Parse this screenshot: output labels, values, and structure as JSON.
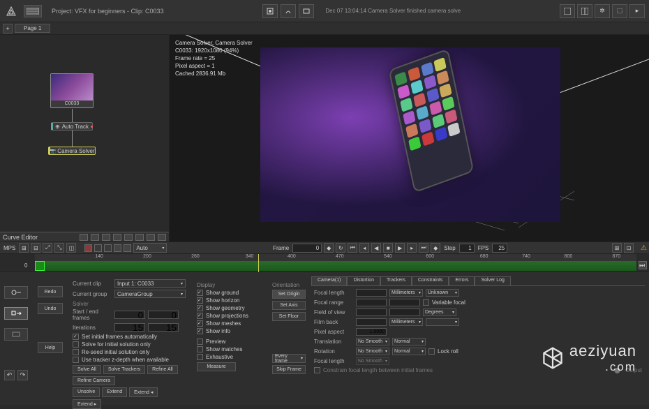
{
  "topbar": {
    "project_label": "Project: VFX for beginners - Clip: C0033",
    "status": "Dec 07 13:04:14 Camera Solver finished camera solve"
  },
  "pagetabs": {
    "tab1": "Page 1"
  },
  "nodes": {
    "clip_name": "C0033",
    "auto_track": "Auto Track",
    "camera_solver": "Camera Solver"
  },
  "viewport_info": {
    "l1": "Camera Solver, Camera Solver",
    "l2": "C0033: 1920x1080 (94%)",
    "l3": "Frame rate = 25",
    "l4": "Pixel aspect = 1",
    "l5": "Cached 2836.91 Mb"
  },
  "curve_editor_label": "Curve Editor",
  "tl_toolbar": {
    "auto_label": "Auto",
    "frame_label": "Frame",
    "frame_value": "0",
    "step_label": "Step",
    "step_value": "1",
    "fps_label": "FPS",
    "fps_value": "25"
  },
  "timeline": {
    "start": "0",
    "ticks": [
      "140",
      "200",
      "260",
      "340",
      "400",
      "470",
      "540",
      "600",
      "680",
      "740",
      "800",
      "870"
    ]
  },
  "actions": {
    "redo": "Redo",
    "undo": "Undo",
    "help": "Help"
  },
  "settings": {
    "current_clip_lab": "Current clip",
    "current_clip_val": "Input 1: C0033",
    "current_group_lab": "Current group",
    "current_group_val": "CameraGroup",
    "solver_header": "Solver",
    "start_end_lab": "Start / end frames",
    "start_val": "0",
    "end_val": "0",
    "iterations_lab": "Iterations",
    "iter_val": "15",
    "iter2_val": "15",
    "chk1": "Set initial frames automatically",
    "chk2": "Solve for initial solution only",
    "chk3": "Re-seed initial solution only",
    "chk4": "Use tracker z-depth when available",
    "btn_solve_all": "Solve All",
    "btn_solve_trackers": "Solve Trackers",
    "btn_refine_all": "Refine All",
    "btn_refine_camera": "Refine Camera",
    "btn_unsolve": "Unsolve",
    "btn_extend": "Extend",
    "btn_extend_l": "Extend ◂",
    "btn_extend_r": "Extend ▸"
  },
  "display": {
    "header": "Display",
    "show_ground": "Show ground",
    "show_horizon": "Show horizon",
    "show_geometry": "Show geometry",
    "show_projections": "Show projections",
    "show_meshes": "Show meshes",
    "show_info": "Show info",
    "preview": "Preview",
    "show_matches": "Show matches",
    "exhaustive": "Exhaustive",
    "btn_measure": "Measure"
  },
  "orientation": {
    "header": "Orientation",
    "set_origin": "Set Origin",
    "set_axis": "Set Axis",
    "set_floor": "Set Floor",
    "every_label": "Every frame",
    "skip_btn": "Skip Frame"
  },
  "tabs": {
    "camera": "Camera(1)",
    "distortion": "Distortion",
    "trackers": "Trackers",
    "constraints": "Constraints",
    "errors": "Errors",
    "solverlog": "Solver Log"
  },
  "camera_panel": {
    "focal_length": "Focal length",
    "focal_length_v": "",
    "focal_units": "Millimeters",
    "focal_mode": "Unknown",
    "focal_range": "Focal range",
    "focal_r1": "",
    "focal_r2": "",
    "var_focal": "Variable focal",
    "fov": "Field of view",
    "fov_v": "",
    "fov_v2": "",
    "degrees": "Degrees",
    "film_back": "Film back",
    "fb_v": "",
    "fb_units": "Millimeters",
    "pixel_aspect": "Pixel aspect",
    "pa_v": "1.0000",
    "translation": "Translation",
    "trans_opt": "No Smooth",
    "trans_mode": "Normal",
    "rotation": "Rotation",
    "rot_opt": "No Smooth",
    "rot_mode": "Normal",
    "lock_roll": "Lock roll",
    "focal_length2": "Focal length",
    "fl2_opt": "No Smooth",
    "constrain_chk": "Constrain focal length between initial frames",
    "output": "Output"
  },
  "watermark": {
    "l1": "aeziyuan",
    "l2": ".com"
  }
}
